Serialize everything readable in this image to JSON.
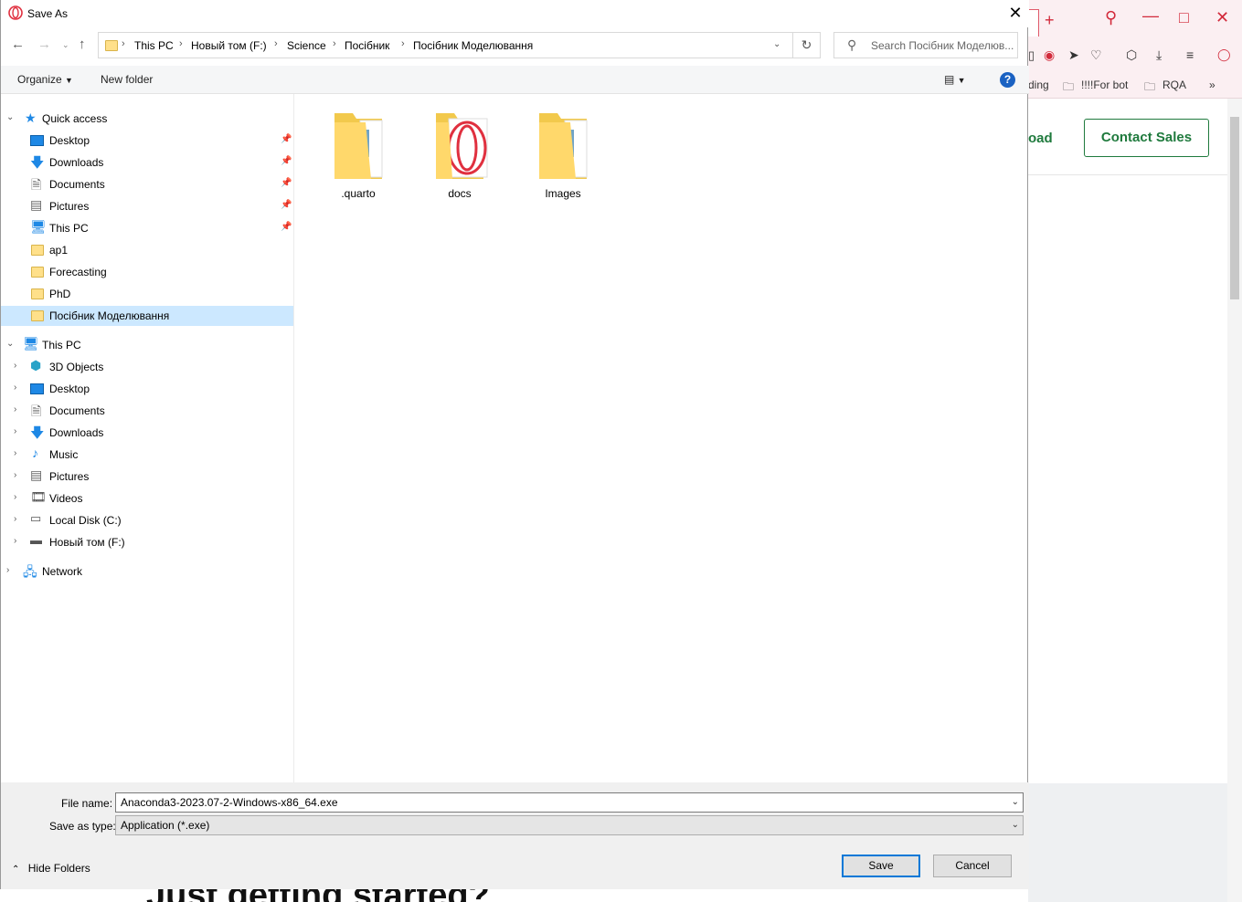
{
  "browser": {
    "bookmarks": [
      "ding",
      "!!!!For bot",
      "RQA"
    ],
    "download_partial": "oad",
    "contact_sales": "Contact Sales",
    "page_heading_partial": "Just getting started?"
  },
  "dialog": {
    "title": "Save As",
    "breadcrumbs": [
      "This PC",
      "Новый том (F:)",
      "Science",
      "Посібник",
      "Посібник Моделювання"
    ],
    "search_placeholder": "Search Посібник Моделюв...",
    "organize_label": "Organize",
    "new_folder_label": "New folder",
    "help_label": "?",
    "quick_access": {
      "label": "Quick access",
      "items": [
        {
          "label": "Desktop",
          "icon": "desktop-icon",
          "pinned": true
        },
        {
          "label": "Downloads",
          "icon": "downloads-icon",
          "pinned": true
        },
        {
          "label": "Documents",
          "icon": "documents-icon",
          "pinned": true
        },
        {
          "label": "Pictures",
          "icon": "pictures-icon",
          "pinned": true
        },
        {
          "label": "This PC",
          "icon": "this-pc-icon",
          "pinned": true
        },
        {
          "label": "ap1",
          "icon": "folder-icon",
          "pinned": false
        },
        {
          "label": "Forecasting",
          "icon": "folder-icon",
          "pinned": false
        },
        {
          "label": "PhD",
          "icon": "folder-icon",
          "pinned": false
        },
        {
          "label": "Посібник Моделювання",
          "icon": "folder-icon",
          "pinned": false,
          "selected": true
        }
      ]
    },
    "this_pc": {
      "label": "This PC",
      "items": [
        {
          "label": "3D Objects",
          "icon": "3d-objects-icon"
        },
        {
          "label": "Desktop",
          "icon": "desktop-icon"
        },
        {
          "label": "Documents",
          "icon": "documents-icon"
        },
        {
          "label": "Downloads",
          "icon": "downloads-icon"
        },
        {
          "label": "Music",
          "icon": "music-icon"
        },
        {
          "label": "Pictures",
          "icon": "pictures-icon"
        },
        {
          "label": "Videos",
          "icon": "videos-icon"
        },
        {
          "label": "Local Disk (C:)",
          "icon": "local-disk-icon"
        },
        {
          "label": "Новый том (F:)",
          "icon": "drive-icon"
        }
      ]
    },
    "network_label": "Network",
    "folders": [
      ".quarto",
      "docs",
      "Images"
    ],
    "file_name_label": "File name:",
    "file_name_value": "Anaconda3-2023.07-2-Windows-x86_64.exe",
    "save_type_label": "Save as type:",
    "save_type_value": "Application (*.exe)",
    "hide_folders_label": "Hide Folders",
    "save_label": "Save",
    "cancel_label": "Cancel",
    "accent_color": "#0078d7",
    "selection_color": "#cce8ff"
  }
}
